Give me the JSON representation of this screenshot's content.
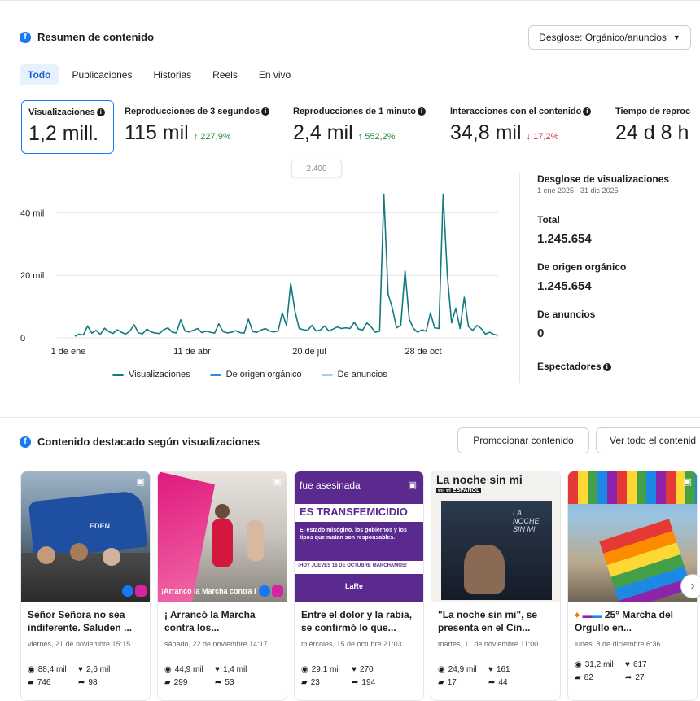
{
  "summary": {
    "title": "Resumen de contenido",
    "breakdown_button": "Desglose: Orgánico/anuncios",
    "tabs": [
      "Todo",
      "Publicaciones",
      "Historias",
      "Reels",
      "En vivo"
    ],
    "metrics": [
      {
        "label": "Visualizaciones",
        "value": "1,2 mill.",
        "change": ""
      },
      {
        "label": "Reproducciones de 3 segundos",
        "value": "115 mil",
        "change": "↑ 227,9%"
      },
      {
        "label": "Reproducciones de 1 minuto",
        "value": "2,4 mil",
        "change": "↑ 552,2%"
      },
      {
        "label": "Interacciones con el contenido",
        "value": "34,8 mil",
        "change": "↓ 17,2%"
      },
      {
        "label": "Tiempo de reproc",
        "value": "24 d 8 h",
        "change": ""
      }
    ],
    "tooltip": "2.400"
  },
  "chart_data": {
    "type": "line",
    "y_ticks": [
      "40 mil",
      "20 mil",
      "0"
    ],
    "ylim": [
      0,
      50000
    ],
    "x_ticks": [
      "1 de ene",
      "11 de abr",
      "20 de jul",
      "28 de oct"
    ],
    "series": [
      {
        "name": "Visualizaciones",
        "color": "#137a7f",
        "values": [
          500,
          1200,
          900,
          3800,
          1500,
          2400,
          1100,
          3100,
          2000,
          1400,
          2600,
          1800,
          1200,
          2200,
          4200,
          1600,
          1300,
          2800,
          1900,
          1500,
          1400,
          2600,
          3200,
          1800,
          1600,
          5800,
          2200,
          1900,
          2400,
          3000,
          1700,
          2100,
          1800,
          1500,
          4500,
          2000,
          1600,
          1800,
          2300,
          1700,
          1500,
          6000,
          2000,
          1800,
          2500,
          3000,
          2200,
          1900,
          2200,
          8000,
          4000,
          17500,
          8500,
          3000,
          2600,
          2400,
          4000,
          2200,
          2500,
          3800,
          2200,
          2800,
          3500,
          3000,
          3200,
          3000,
          5000,
          2800,
          2500,
          4800,
          3500,
          1800,
          2100,
          46000,
          14000,
          9500,
          3200,
          4000,
          21500,
          6000,
          3000,
          1800,
          2600,
          2100,
          8000,
          3200,
          3000,
          46000,
          20000,
          4800,
          9500,
          3000,
          13000,
          3600,
          2400,
          4000,
          3000,
          1200,
          1800,
          1100,
          800
        ]
      },
      {
        "name": "De origen orgánico",
        "color": "#2d8de8"
      },
      {
        "name": "De anuncios",
        "color": "#9fd0f5"
      }
    ]
  },
  "breakdown": {
    "title": "Desglose de visualizaciones",
    "range": "1 ene 2025 - 31 dic 2025",
    "total_label": "Total",
    "total_value": "1.245.654",
    "organic_label": "De origen orgánico",
    "organic_value": "1.245.654",
    "ads_label": "De anuncios",
    "ads_value": "0",
    "viewers_label": "Espectadores"
  },
  "featured": {
    "title": "Contenido destacado según visualizaciones",
    "promote_button": "Promocionar contenido",
    "see_all_button": "Ver todo el contenid",
    "cards": [
      {
        "title": "Señor Señora no sea indiferente. Saluden ...",
        "date": "viernes, 21 de noviembre 15:15",
        "views": "88,4 mil",
        "likes": "2,6 mil",
        "comments": "746",
        "shares": "98",
        "overlay": "",
        "thumb": "bus"
      },
      {
        "title": "¡ Arrancó la Marcha contra los...",
        "date": "sábado, 22 de noviembre 14:17",
        "views": "44,9 mil",
        "likes": "1,4 mil",
        "comments": "299",
        "shares": "53",
        "overlay": "¡Arrancó la Marcha contra l",
        "thumb": "march"
      },
      {
        "title": "Entre el dolor y la rabia, se confirmó lo que...",
        "date": "miércoles, 15 de octubre 21:03",
        "views": "29,1 mil",
        "likes": "270",
        "comments": "23",
        "shares": "194",
        "overlay": "",
        "thumb": "purple",
        "purple": {
          "l1": "fue asesinada",
          "l2": "ES TRANSFEMICIDIO",
          "l3": "El estado misógino, los gobiernos y los tipos que matan son responsables.",
          "l4": "¡HOY JUEVES 16 DE OCTUBRE MARCHAMOS!",
          "l5": "LaRe"
        }
      },
      {
        "title": "\"La noche sin mi\", se presenta en el Cin...",
        "date": "martes, 11 de noviembre 11:00",
        "views": "24,9 mil",
        "likes": "161",
        "comments": "17",
        "shares": "44",
        "overlay": "",
        "thumb": "poster",
        "poster": {
          "top": "La noche sin mi",
          "sub": "en el ESPAÑOL",
          "inner": "LA NOCHE SIN MI"
        }
      },
      {
        "title": "25° Marcha del Orgullo en...",
        "date": "lunes, 8 de diciembre 6:36",
        "views": "31,2 mil",
        "likes": "617",
        "comments": "82",
        "shares": "27",
        "overlay": "",
        "thumb": "pride"
      }
    ]
  }
}
